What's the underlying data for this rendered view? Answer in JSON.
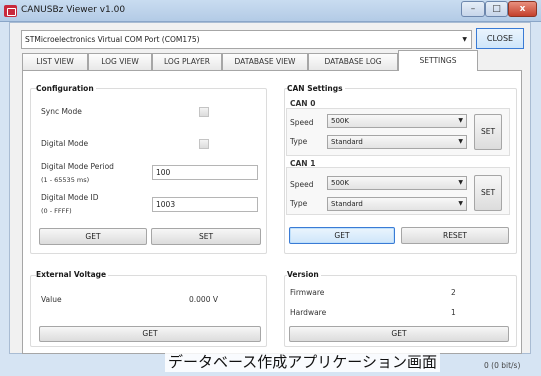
{
  "window": {
    "title": "CANUSBz Viewer v1.00",
    "close_glyph": "x",
    "max_glyph": "□",
    "min_glyph": "–"
  },
  "port": {
    "selected": "STMicroelectronics Virtual COM Port (COM175)",
    "close_label": "CLOSE"
  },
  "tabs": [
    "LIST VIEW",
    "LOG VIEW",
    "LOG PLAYER",
    "DATABASE VIEW",
    "DATABASE LOG",
    "SETTINGS"
  ],
  "active_tab": "SETTINGS",
  "configuration": {
    "title": "Configuration",
    "sync_mode": "Sync Mode",
    "digital_mode": "Digital Mode",
    "period_label": "Digital Mode Period",
    "period_range": "(1 - 65535 ms)",
    "period_value": "100",
    "id_label": "Digital Mode ID",
    "id_range": "(0 - FFFF)",
    "id_value": "1003",
    "get_label": "GET",
    "set_label": "SET"
  },
  "can_settings": {
    "title": "CAN Settings",
    "can0": {
      "title": "CAN 0",
      "speed_label": "Speed",
      "speed": "500K",
      "type_label": "Type",
      "type": "Standard",
      "set_label": "SET"
    },
    "can1": {
      "title": "CAN 1",
      "speed_label": "Speed",
      "speed": "500K",
      "type_label": "Type",
      "type": "Standard",
      "set_label": "SET"
    },
    "get_label": "GET",
    "reset_label": "RESET"
  },
  "external_voltage": {
    "title": "External Voltage",
    "value_label": "Value",
    "value": "0.000 V",
    "get_label": "GET"
  },
  "version": {
    "title": "Version",
    "firmware_label": "Firmware",
    "firmware": "2",
    "hardware_label": "Hardware",
    "hardware": "1",
    "get_label": "GET"
  },
  "status": {
    "rate": "0 (0 bit/s)"
  },
  "caption": "データベース作成アプリケーション画面",
  "colors": {
    "accent": "#3a7bd5",
    "title_close": "#c4402c",
    "app_icon": "#c8283c"
  }
}
